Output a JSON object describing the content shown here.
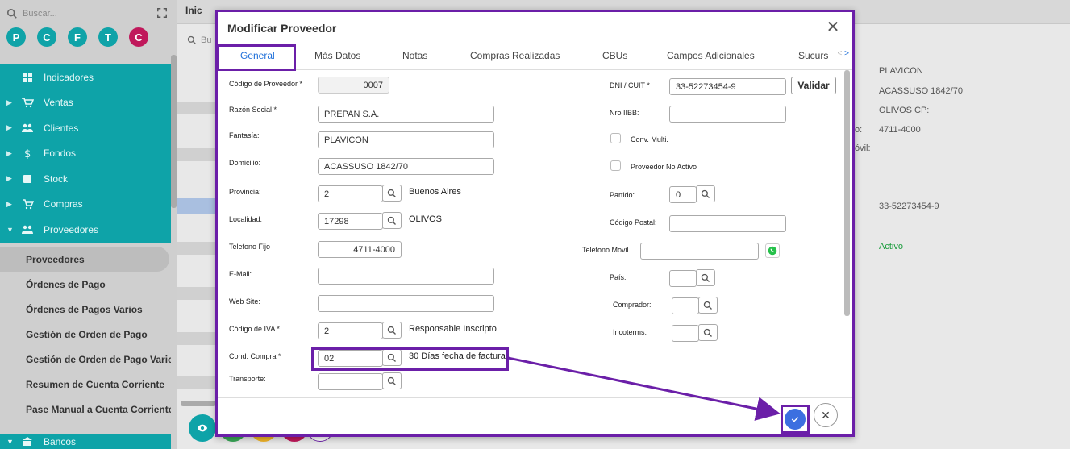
{
  "sidebar": {
    "search_placeholder": "Buscar...",
    "circles": [
      "P",
      "C",
      "F",
      "T",
      "C"
    ],
    "menu": [
      {
        "label": "Indicadores",
        "icon": "grid-icon"
      },
      {
        "label": "Ventas",
        "icon": "cart-icon"
      },
      {
        "label": "Clientes",
        "icon": "people-icon"
      },
      {
        "label": "Fondos",
        "icon": "dollar-icon"
      },
      {
        "label": "Stock",
        "icon": "box-icon"
      },
      {
        "label": "Compras",
        "icon": "basket-icon"
      },
      {
        "label": "Proveedores",
        "icon": "people-icon"
      }
    ],
    "submenu": [
      "Proveedores",
      "Órdenes de Pago",
      "Órdenes de Pagos Varios",
      "Gestión de Orden de Pago",
      "Gestión de Orden de Pago Varios",
      "Resumen de Cuenta Corriente",
      "Pase Manual a Cuenta Corriente"
    ],
    "bottom_item": "Bancos"
  },
  "background": {
    "tab_label": "Inic",
    "search_placeholder": "Bu",
    "right_labels": [
      "PLAVICON",
      "ACASSUSO 1842/70",
      "OLIVOS  CP:",
      "4711-4000",
      "33-52273454-9",
      "Activo"
    ],
    "left_fragments": [
      "o:",
      "óvil:"
    ]
  },
  "modal": {
    "title": "Modificar Proveedor",
    "tabs": [
      "General",
      "Más Datos",
      "Notas",
      "Compras Realizadas",
      "CBUs",
      "Campos Adicionales",
      "Sucurs"
    ],
    "fields": {
      "codigo_label": "Código de Proveedor *",
      "codigo_value": "0007",
      "razon_label": "Razón Social *",
      "razon_value": "PREPAN S.A.",
      "fantasia_label": "Fantasía:",
      "fantasia_value": "PLAVICON",
      "domicilio_label": "Domicilio:",
      "domicilio_value": "ACASSUSO 1842/70",
      "provincia_label": "Provincia:",
      "provincia_value": "2",
      "provincia_desc": "Buenos Aires",
      "localidad_label": "Localidad:",
      "localidad_value": "17298",
      "localidad_desc": "OLIVOS",
      "telfijo_label": "Telefono Fijo",
      "telfijo_value": "4711-4000",
      "email_label": "E-Mail:",
      "web_label": "Web Site:",
      "iva_label": "Código de IVA *",
      "iva_value": "2",
      "iva_desc": "Responsable Inscripto",
      "cond_label": "Cond. Compra *",
      "cond_value": "02",
      "cond_desc": "30 Días fecha de factura",
      "transporte_label": "Transporte:",
      "dni_label": "DNI / CUIT *",
      "dni_value": "33-52273454-9",
      "validar_label": "Validar",
      "iibb_label": "Nro IIBB:",
      "conv_label": "Conv. Multi.",
      "noactivo_label": "Proveedor No Activo",
      "partido_label": "Partido:",
      "partido_value": "0",
      "cp_label": "Código Postal:",
      "telmovil_label": "Telefono Movil",
      "pais_label": "País:",
      "comprador_label": "Comprador:",
      "incoterms_label": "Incoterms:"
    }
  },
  "colors": {
    "accent_teal": "#0ea3a8",
    "highlight_purple": "#6b1fa8",
    "tab_blue": "#1e6fd9",
    "ok_blue": "#3c6fe0"
  }
}
